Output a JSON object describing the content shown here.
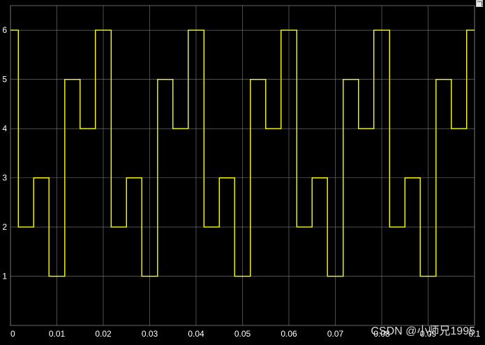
{
  "chart_data": {
    "type": "line",
    "title": "",
    "xlabel": "",
    "ylabel": "",
    "xlim": [
      0,
      0.1
    ],
    "ylim": [
      0.0,
      6.5
    ],
    "grid": true,
    "x_ticks": [
      "0",
      "0.01",
      "0.02",
      "0.03",
      "0.04",
      "0.05",
      "0.06",
      "0.07",
      "0.08",
      "0.09",
      "0.1"
    ],
    "y_ticks": [
      "1",
      "2",
      "3",
      "4",
      "5",
      "6"
    ],
    "colors": {
      "background": "#000000",
      "grid": "#7f7f7f",
      "line": "#ffff00"
    },
    "series": [
      {
        "style": "step",
        "x": [
          0,
          0.0017,
          0.005,
          0.0083,
          0.0117,
          0.015,
          0.0183,
          0.0217,
          0.025,
          0.0283,
          0.0317,
          0.035,
          0.0383,
          0.0417,
          0.045,
          0.0483,
          0.0517,
          0.055,
          0.0583,
          0.0617,
          0.065,
          0.0683,
          0.0717,
          0.075,
          0.0783,
          0.0817,
          0.085,
          0.0883,
          0.0917,
          0.095,
          0.0983,
          0.1
        ],
        "y": [
          6,
          2,
          3,
          1,
          5,
          4,
          6,
          2,
          3,
          1,
          5,
          4,
          6,
          2,
          3,
          1,
          5,
          4,
          6,
          2,
          3,
          1,
          5,
          4,
          6,
          2,
          3,
          1,
          5,
          4,
          6,
          6
        ]
      }
    ]
  },
  "watermark": "CSDN @小师兄1995"
}
